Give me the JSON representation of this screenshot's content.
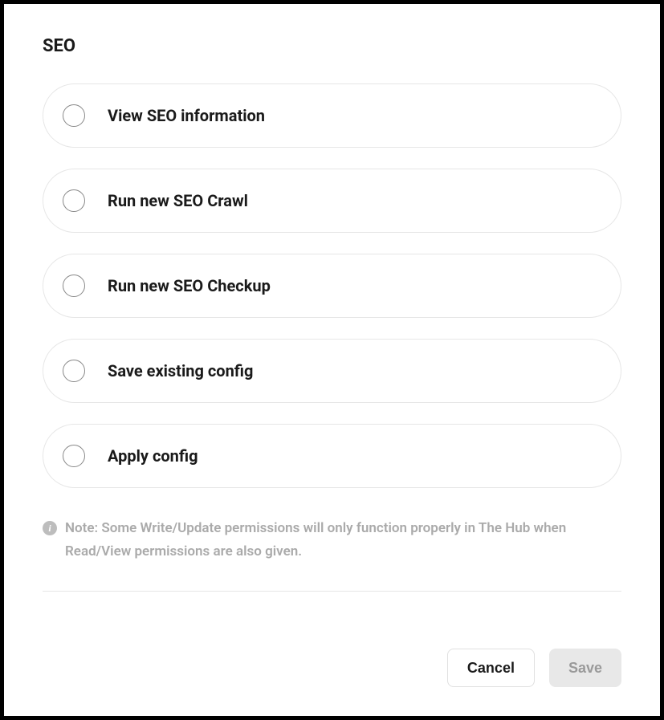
{
  "section": {
    "title": "SEO"
  },
  "options": [
    {
      "label": "View SEO information"
    },
    {
      "label": "Run new SEO Crawl"
    },
    {
      "label": "Run new SEO Checkup"
    },
    {
      "label": "Save existing config"
    },
    {
      "label": "Apply config"
    }
  ],
  "note": {
    "text": "Note: Some Write/Update permissions will only function properly in The Hub when Read/View permissions are also given."
  },
  "actions": {
    "cancel_label": "Cancel",
    "save_label": "Save"
  }
}
